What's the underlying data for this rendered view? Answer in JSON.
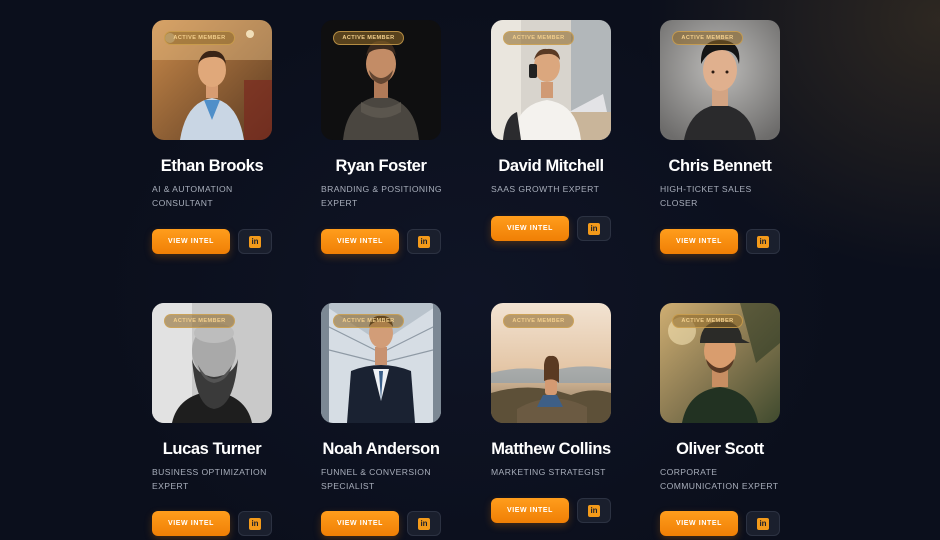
{
  "badge_label": "ACTIVE MEMBER",
  "view_label": "VIEW INTEL",
  "linkedin_icon": "in",
  "colors": {
    "accent": "#f7900f",
    "badge_text": "#f3cf8c",
    "role_text": "#a8aebb",
    "background": "#0b0f1c"
  },
  "members": [
    {
      "name": "Ethan Brooks",
      "role": "AI & AUTOMATION CONSULTANT",
      "photo": "man-light-blazer-restaurant"
    },
    {
      "name": "Ryan Foster",
      "role": "BRANDING & POSITIONING EXPERT",
      "photo": "man-dark-sweater"
    },
    {
      "name": "David Mitchell",
      "role": "SAAS GROWTH EXPERT",
      "photo": "man-phone-laptop"
    },
    {
      "name": "Chris Bennett",
      "role": "HIGH-TICKET SALES CLOSER",
      "photo": "young-man-portrait"
    },
    {
      "name": "Lucas Turner",
      "role": "BUSINESS OPTIMIZATION EXPERT",
      "photo": "bald-bearded-man-bw"
    },
    {
      "name": "Noah Anderson",
      "role": "FUNNEL & CONVERSION SPECIALIST",
      "photo": "man-suit-glass-building"
    },
    {
      "name": "Matthew Collins",
      "role": "MARKETING STRATEGIST",
      "photo": "woman-sitting-rock-coast"
    },
    {
      "name": "Oliver Scott",
      "role": "CORPORATE COMMUNICATION EXPERT",
      "photo": "man-cap-sunset"
    }
  ]
}
